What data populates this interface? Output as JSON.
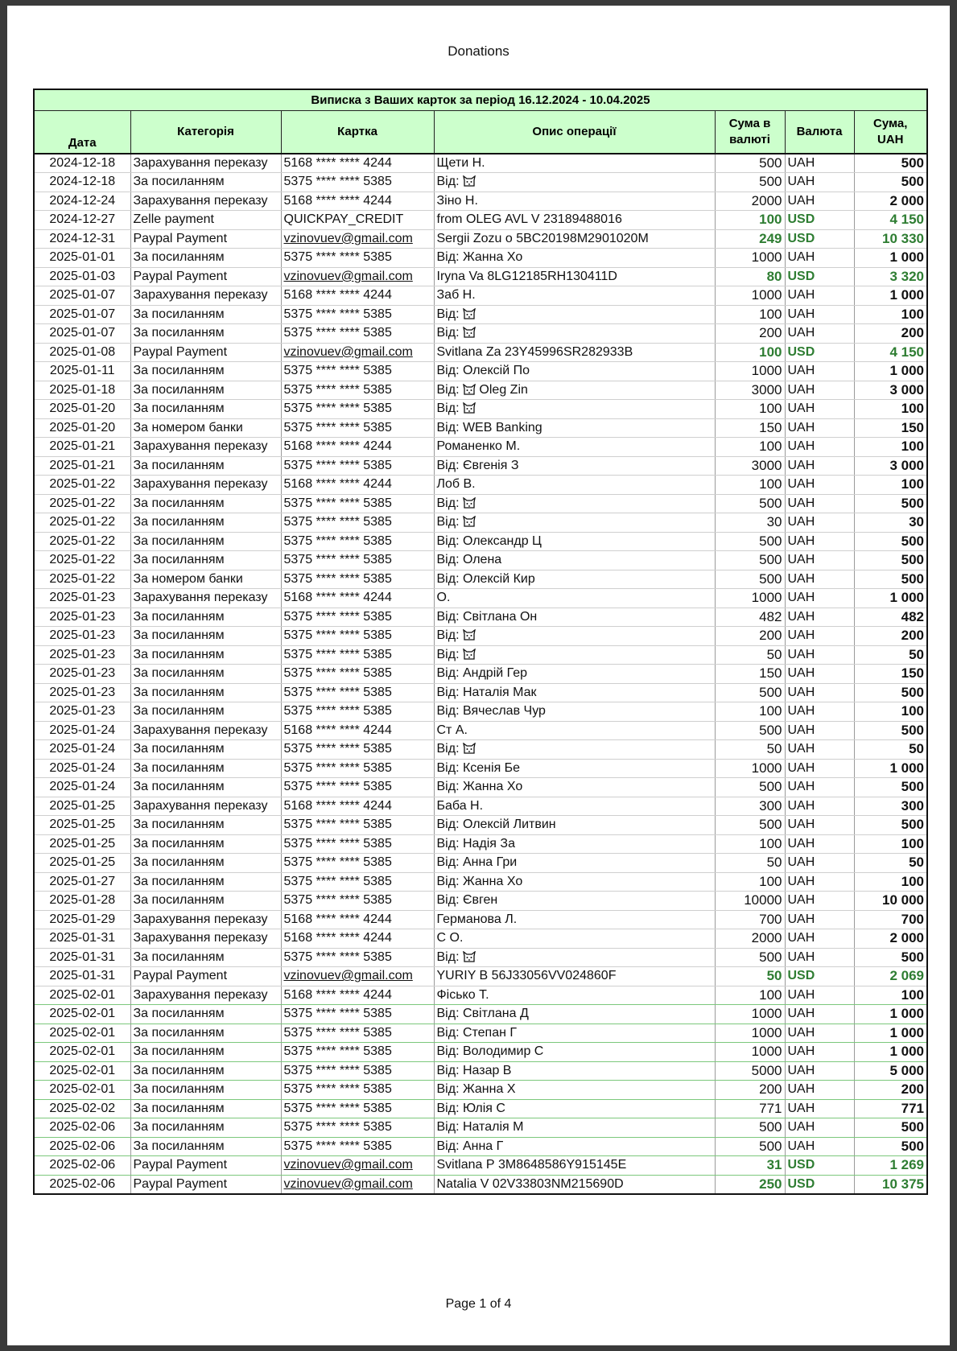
{
  "document": {
    "title": "Donations",
    "footer": "Page 1 of 4"
  },
  "statement": {
    "title": "Виписка з Ваших карток за період 16.12.2024 - 10.04.2025",
    "headers": {
      "date": "Дата",
      "category": "Категорія",
      "card": "Картка",
      "description": "Опис операції",
      "amount_line1": "Сума в",
      "amount_line2": "валюті",
      "currency": "Валюта",
      "uah_line1": "Сума,",
      "uah_line2": "UAH"
    },
    "colors": {
      "header_bg": "#ccffcc",
      "usd_text": "#2e7d32"
    },
    "rows": [
      {
        "date": "2024-12-18",
        "category": "Зарахування переказу",
        "card": "5168 **** **** 4244",
        "desc": "Щети      Н.",
        "amount": "500",
        "currency": "UAH",
        "uah": "500"
      },
      {
        "date": "2024-12-18",
        "category": "За посиланням",
        "card": "5375 **** **** 5385",
        "desc": "Від:",
        "icon": "cat-icon",
        "amount": "500",
        "currency": "UAH",
        "uah": "500"
      },
      {
        "date": "2024-12-24",
        "category": "Зарахування переказу",
        "card": "5168 **** **** 4244",
        "desc": "Зіно       Н.",
        "amount": "2000",
        "currency": "UAH",
        "uah": "2 000"
      },
      {
        "date": "2024-12-27",
        "category": "Zelle payment",
        "card": "QUICKPAY_CREDIT",
        "desc": "from OLEG AVL       V 23189488016",
        "amount": "100",
        "currency": "USD",
        "uah": "4 150"
      },
      {
        "date": "2024-12-31",
        "category": "Paypal Payment",
        "card": "vzinovuev@gmail.com",
        "desc": "Sergii Zozu     o 5BC20198M2901020M",
        "amount": "249",
        "currency": "USD",
        "uah": "10 330"
      },
      {
        "date": "2025-01-01",
        "category": "За посиланням",
        "card": "5375 **** **** 5385",
        "desc": "Від: Жанна Хо",
        "amount": "1000",
        "currency": "UAH",
        "uah": "1 000"
      },
      {
        "date": "2025-01-03",
        "category": "Paypal Payment",
        "card": "vzinovuev@gmail.com",
        "desc": "Iryna Va       8LG12185RH130411D",
        "amount": "80",
        "currency": "USD",
        "uah": "3 320"
      },
      {
        "date": "2025-01-07",
        "category": "Зарахування переказу",
        "card": "5168 **** **** 4244",
        "desc": "Заб       Н.",
        "amount": "1000",
        "currency": "UAH",
        "uah": "1 000"
      },
      {
        "date": "2025-01-07",
        "category": "За посиланням",
        "card": "5375 **** **** 5385",
        "desc": "Від:",
        "icon": "cat-icon",
        "amount": "100",
        "currency": "UAH",
        "uah": "100"
      },
      {
        "date": "2025-01-07",
        "category": "За посиланням",
        "card": "5375 **** **** 5385",
        "desc": "Від:",
        "icon": "cat-icon",
        "amount": "200",
        "currency": "UAH",
        "uah": "200"
      },
      {
        "date": "2025-01-08",
        "category": "Paypal Payment",
        "card": "vzinovuev@gmail.com",
        "desc": "Svitlana Za        23Y45996SR282933B",
        "amount": "100",
        "currency": "USD",
        "uah": "4 150"
      },
      {
        "date": "2025-01-11",
        "category": "За посиланням",
        "card": "5375 **** **** 5385",
        "desc": "Від: Олексій По",
        "amount": "1000",
        "currency": "UAH",
        "uah": "1 000"
      },
      {
        "date": "2025-01-18",
        "category": "За посиланням",
        "card": "5375 **** **** 5385",
        "desc": "Від:",
        "icon": "cat-icon",
        "desc_after": "Oleg Zin",
        "amount": "3000",
        "currency": "UAH",
        "uah": "3 000"
      },
      {
        "date": "2025-01-20",
        "category": "За посиланням",
        "card": "5375 **** **** 5385",
        "desc": "Від:",
        "icon": "cat-icon",
        "amount": "100",
        "currency": "UAH",
        "uah": "100"
      },
      {
        "date": "2025-01-20",
        "category": "За номером банки",
        "card": "5375 **** **** 5385",
        "desc": "Від: WEB Banking",
        "amount": "150",
        "currency": "UAH",
        "uah": "150"
      },
      {
        "date": "2025-01-21",
        "category": "Зарахування переказу",
        "card": "5168 **** **** 4244",
        "desc": "Романенко М.",
        "amount": "100",
        "currency": "UAH",
        "uah": "100"
      },
      {
        "date": "2025-01-21",
        "category": "За посиланням",
        "card": "5375 **** **** 5385",
        "desc": "Від: Євгенія З",
        "amount": "3000",
        "currency": "UAH",
        "uah": "3 000"
      },
      {
        "date": "2025-01-22",
        "category": "Зарахування переказу",
        "card": "5168 **** **** 4244",
        "desc": "Лоб       В.",
        "amount": "100",
        "currency": "UAH",
        "uah": "100"
      },
      {
        "date": "2025-01-22",
        "category": "За посиланням",
        "card": "5375 **** **** 5385",
        "desc": "Від:",
        "icon": "cat-icon",
        "amount": "500",
        "currency": "UAH",
        "uah": "500"
      },
      {
        "date": "2025-01-22",
        "category": "За посиланням",
        "card": "5375 **** **** 5385",
        "desc": "Від:",
        "icon": "cat-icon",
        "amount": "30",
        "currency": "UAH",
        "uah": "30"
      },
      {
        "date": "2025-01-22",
        "category": "За посиланням",
        "card": "5375 **** **** 5385",
        "desc": "Від: Олександр Ц",
        "amount": "500",
        "currency": "UAH",
        "uah": "500"
      },
      {
        "date": "2025-01-22",
        "category": "За посиланням",
        "card": "5375 **** **** 5385",
        "desc": "Від: Олена",
        "amount": "500",
        "currency": "UAH",
        "uah": "500"
      },
      {
        "date": "2025-01-22",
        "category": "За номером банки",
        "card": "5375 **** **** 5385",
        "desc": "Від: Олексій Кир",
        "amount": "500",
        "currency": "UAH",
        "uah": "500"
      },
      {
        "date": "2025-01-23",
        "category": "Зарахування переказу",
        "card": "5168 **** **** 4244",
        "desc": "О.",
        "amount": "1000",
        "currency": "UAH",
        "uah": "1 000"
      },
      {
        "date": "2025-01-23",
        "category": "За посиланням",
        "card": "5375 **** **** 5385",
        "desc": "Від: Світлана Он",
        "amount": "482",
        "currency": "UAH",
        "uah": "482"
      },
      {
        "date": "2025-01-23",
        "category": "За посиланням",
        "card": "5375 **** **** 5385",
        "desc": "Від:",
        "icon": "cat-icon",
        "amount": "200",
        "currency": "UAH",
        "uah": "200"
      },
      {
        "date": "2025-01-23",
        "category": "За посиланням",
        "card": "5375 **** **** 5385",
        "desc": "Від:",
        "icon": "cat-icon",
        "amount": "50",
        "currency": "UAH",
        "uah": "50"
      },
      {
        "date": "2025-01-23",
        "category": "За посиланням",
        "card": "5375 **** **** 5385",
        "desc": "Від: Андрій Гер",
        "amount": "150",
        "currency": "UAH",
        "uah": "150"
      },
      {
        "date": "2025-01-23",
        "category": "За посиланням",
        "card": "5375 **** **** 5385",
        "desc": "Від: Наталія Мак",
        "amount": "500",
        "currency": "UAH",
        "uah": "500"
      },
      {
        "date": "2025-01-23",
        "category": "За посиланням",
        "card": "5375 **** **** 5385",
        "desc": "Від: Вячеслав Чур",
        "amount": "100",
        "currency": "UAH",
        "uah": "100"
      },
      {
        "date": "2025-01-24",
        "category": "Зарахування переказу",
        "card": "5168 **** **** 4244",
        "desc": "Ст      А.",
        "amount": "500",
        "currency": "UAH",
        "uah": "500"
      },
      {
        "date": "2025-01-24",
        "category": "За посиланням",
        "card": "5375 **** **** 5385",
        "desc": "Від:",
        "icon": "cat-icon",
        "amount": "50",
        "currency": "UAH",
        "uah": "50"
      },
      {
        "date": "2025-01-24",
        "category": "За посиланням",
        "card": "5375 **** **** 5385",
        "desc": "Від: Ксенія Бе",
        "amount": "1000",
        "currency": "UAH",
        "uah": "1 000"
      },
      {
        "date": "2025-01-24",
        "category": "За посиланням",
        "card": "5375 **** **** 5385",
        "desc": "Від: Жанна Хо",
        "amount": "500",
        "currency": "UAH",
        "uah": "500"
      },
      {
        "date": "2025-01-25",
        "category": "Зарахування переказу",
        "card": "5168 **** **** 4244",
        "desc": "Баба       Н.",
        "amount": "300",
        "currency": "UAH",
        "uah": "300"
      },
      {
        "date": "2025-01-25",
        "category": "За посиланням",
        "card": "5375 **** **** 5385",
        "desc": "Від: Олексій Литвин",
        "amount": "500",
        "currency": "UAH",
        "uah": "500"
      },
      {
        "date": "2025-01-25",
        "category": "За посиланням",
        "card": "5375 **** **** 5385",
        "desc": "Від: Надія За",
        "amount": "100",
        "currency": "UAH",
        "uah": "100"
      },
      {
        "date": "2025-01-25",
        "category": "За посиланням",
        "card": "5375 **** **** 5385",
        "desc": "Від: Анна Гри",
        "amount": "50",
        "currency": "UAH",
        "uah": "50"
      },
      {
        "date": "2025-01-27",
        "category": "За посиланням",
        "card": "5375 **** **** 5385",
        "desc": "Від: Жанна Хо",
        "amount": "100",
        "currency": "UAH",
        "uah": "100"
      },
      {
        "date": "2025-01-28",
        "category": "За посиланням",
        "card": "5375 **** **** 5385",
        "desc": "Від: Євген",
        "amount": "10000",
        "currency": "UAH",
        "uah": "10 000"
      },
      {
        "date": "2025-01-29",
        "category": "Зарахування переказу",
        "card": "5168 **** **** 4244",
        "desc": "Германова Л.",
        "amount": "700",
        "currency": "UAH",
        "uah": "700"
      },
      {
        "date": "2025-01-31",
        "category": "Зарахування переказу",
        "card": "5168 **** **** 4244",
        "desc": "С       О.",
        "amount": "2000",
        "currency": "UAH",
        "uah": "2 000"
      },
      {
        "date": "2025-01-31",
        "category": "За посиланням",
        "card": "5375 **** **** 5385",
        "desc": "Від:",
        "icon": "cat-icon",
        "amount": "500",
        "currency": "UAH",
        "uah": "500"
      },
      {
        "date": "2025-01-31",
        "category": "Paypal Payment",
        "card": "vzinovuev@gmail.com",
        "desc": "YURIY B        56J33056VV024860F",
        "amount": "50",
        "currency": "USD",
        "uah": "2 069"
      },
      {
        "date": "2025-02-01",
        "category": "Зарахування переказу",
        "card": "5168 **** **** 4244",
        "desc": "Фісько Т.",
        "amount": "100",
        "currency": "UAH",
        "uah": "100"
      },
      {
        "date": "2025-02-01",
        "category": "За посиланням",
        "card": "5375 **** **** 5385",
        "desc": "Від: Світлана Д",
        "amount": "1000",
        "currency": "UAH",
        "uah": "1 000"
      },
      {
        "date": "2025-02-01",
        "category": "За посиланням",
        "card": "5375 **** **** 5385",
        "desc": "Від: Степан Г",
        "amount": "1000",
        "currency": "UAH",
        "uah": "1 000"
      },
      {
        "date": "2025-02-01",
        "category": "За посиланням",
        "card": "5375 **** **** 5385",
        "desc": "Від: Володимир С",
        "amount": "1000",
        "currency": "UAH",
        "uah": "1 000"
      },
      {
        "date": "2025-02-01",
        "category": "За посиланням",
        "card": "5375 **** **** 5385",
        "desc": "Від: Назар В",
        "amount": "5000",
        "currency": "UAH",
        "uah": "5 000"
      },
      {
        "date": "2025-02-01",
        "category": "За посиланням",
        "card": "5375 **** **** 5385",
        "desc": "Від: Жанна Х",
        "amount": "200",
        "currency": "UAH",
        "uah": "200"
      },
      {
        "date": "2025-02-02",
        "category": "За посиланням",
        "card": "5375 **** **** 5385",
        "desc": "Від: Юлія С",
        "amount": "771",
        "currency": "UAH",
        "uah": "771"
      },
      {
        "date": "2025-02-06",
        "category": "За посиланням",
        "card": "5375 **** **** 5385",
        "desc": "Від: Наталія М",
        "amount": "500",
        "currency": "UAH",
        "uah": "500"
      },
      {
        "date": "2025-02-06",
        "category": "За посиланням",
        "card": "5375 **** **** 5385",
        "desc": "Від: Анна Г",
        "amount": "500",
        "currency": "UAH",
        "uah": "500"
      },
      {
        "date": "2025-02-06",
        "category": "Paypal Payment",
        "card": "vzinovuev@gmail.com",
        "desc": "Svitlana Р       3M8648586Y915145E",
        "amount": "31",
        "currency": "USD",
        "uah": "1 269"
      },
      {
        "date": "2025-02-06",
        "category": "Paypal Payment",
        "card": "vzinovuev@gmail.com",
        "desc": "Natalia V       02V33803NM215690D",
        "amount": "250",
        "currency": "USD",
        "uah": "10 375"
      }
    ]
  }
}
